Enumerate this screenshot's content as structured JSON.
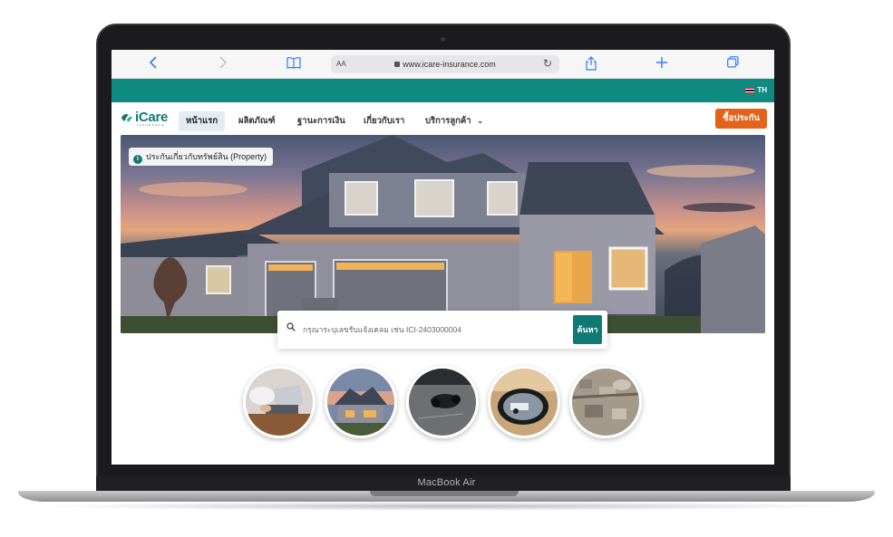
{
  "device": {
    "label": "MacBook Air"
  },
  "browser": {
    "back_icon": "chevron-left-icon",
    "forward_icon": "chevron-right-icon",
    "bookmarks_icon": "book-icon",
    "text_size": "AA",
    "url": "www.icare-insurance.com",
    "reload_icon": "reload-icon",
    "share_icon": "share-icon",
    "new_tab_icon": "plus-icon",
    "tabs_icon": "tabs-icon"
  },
  "site": {
    "language": "TH",
    "logo_text": "iCare",
    "logo_sub": "INSURANCE",
    "nav": [
      {
        "label": "หน้าแรก",
        "active": true
      },
      {
        "label": "ผลิตภัณฑ์",
        "active": false
      },
      {
        "label": "ฐานะการเงิน",
        "active": false
      },
      {
        "label": "เกี่ยวกับเรา",
        "active": false
      },
      {
        "label": "บริการลูกค้า",
        "active": false,
        "dropdown": true
      }
    ],
    "buy_button": "ซื้อประกัน",
    "brand_color": "#0f8a80",
    "accent_color": "#e5621b"
  },
  "hero": {
    "badge": "ประกันเกี่ยวกับทรัพย์สิน (Property)"
  },
  "search": {
    "placeholder": "กรุณาระบุเลขรับแจ้งเคลม เช่น ICI-2403000004",
    "button": "ค้นหา"
  },
  "categories": [
    {
      "icon": "laptop-work-image"
    },
    {
      "icon": "house-image"
    },
    {
      "icon": "motorcycle-accident-image"
    },
    {
      "icon": "car-mirror-accident-image"
    },
    {
      "icon": "disaster-aerial-image"
    }
  ]
}
